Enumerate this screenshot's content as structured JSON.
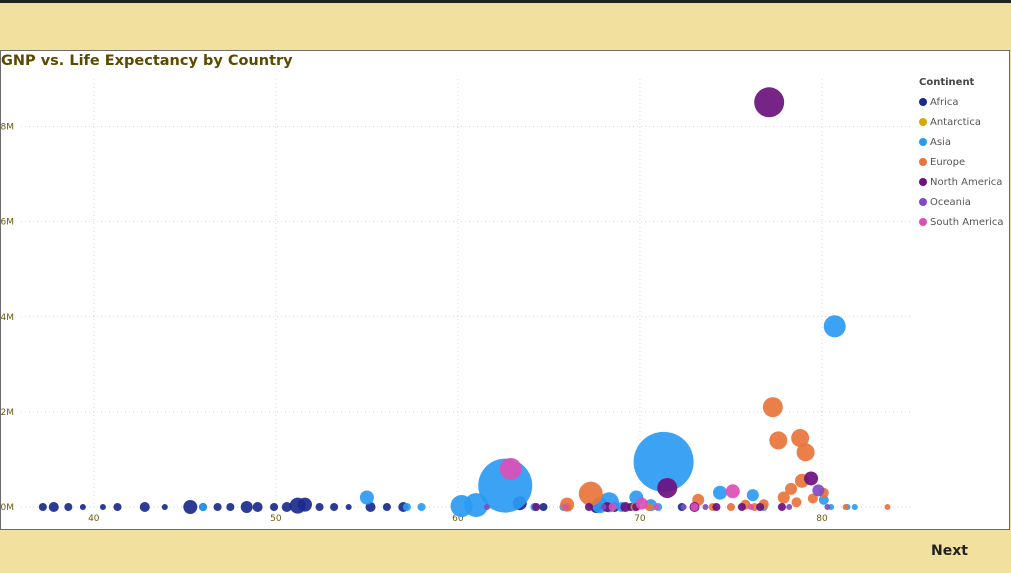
{
  "navigation": {
    "next_label": "Next"
  },
  "chart_data": {
    "type": "scatter",
    "title": "GNP vs. Life Expectancy by Country",
    "xlabel": "",
    "ylabel": "",
    "xlim": [
      36,
      85
    ],
    "ylim": [
      0,
      9000000
    ],
    "x_ticks": [
      40,
      50,
      60,
      70,
      80
    ],
    "y_ticks": [
      {
        "value": 0,
        "label": "0M"
      },
      {
        "value": 2000000,
        "label": "2M"
      },
      {
        "value": 4000000,
        "label": "4M"
      },
      {
        "value": 6000000,
        "label": "6M"
      },
      {
        "value": 8000000,
        "label": "8M"
      }
    ],
    "grid": "dotted",
    "legend_title": "Continent",
    "legend_position": "right",
    "series": [
      {
        "name": "Africa",
        "color": "#1a2a8c",
        "points": [
          {
            "x": 37.2,
            "y": 0,
            "size": 4
          },
          {
            "x": 37.8,
            "y": 0,
            "size": 5
          },
          {
            "x": 38.6,
            "y": 0,
            "size": 4
          },
          {
            "x": 39.4,
            "y": 0,
            "size": 3
          },
          {
            "x": 40.5,
            "y": 0,
            "size": 3
          },
          {
            "x": 41.3,
            "y": 0,
            "size": 4
          },
          {
            "x": 42.8,
            "y": 0,
            "size": 5
          },
          {
            "x": 43.9,
            "y": 0,
            "size": 3
          },
          {
            "x": 45.3,
            "y": 0,
            "size": 7
          },
          {
            "x": 46.0,
            "y": 0,
            "size": 4
          },
          {
            "x": 46.8,
            "y": 0,
            "size": 4
          },
          {
            "x": 47.5,
            "y": 0,
            "size": 4
          },
          {
            "x": 48.4,
            "y": 0,
            "size": 6
          },
          {
            "x": 49.0,
            "y": 0,
            "size": 5
          },
          {
            "x": 49.9,
            "y": 0,
            "size": 4
          },
          {
            "x": 50.6,
            "y": 0,
            "size": 5
          },
          {
            "x": 51.2,
            "y": 30000,
            "size": 8
          },
          {
            "x": 51.6,
            "y": 50000,
            "size": 7
          },
          {
            "x": 52.4,
            "y": 0,
            "size": 4
          },
          {
            "x": 53.2,
            "y": 0,
            "size": 4
          },
          {
            "x": 54.0,
            "y": 0,
            "size": 3
          },
          {
            "x": 55.2,
            "y": 0,
            "size": 5
          },
          {
            "x": 56.1,
            "y": 0,
            "size": 4
          },
          {
            "x": 57.0,
            "y": 0,
            "size": 5
          },
          {
            "x": 63.4,
            "y": 80000,
            "size": 7
          },
          {
            "x": 64.7,
            "y": 0,
            "size": 4
          },
          {
            "x": 66.0,
            "y": 0,
            "size": 4
          },
          {
            "x": 67.6,
            "y": 0,
            "size": 6
          },
          {
            "x": 68.6,
            "y": 0,
            "size": 5
          },
          {
            "x": 69.5,
            "y": 0,
            "size": 4
          },
          {
            "x": 72.3,
            "y": 0,
            "size": 4
          }
        ]
      },
      {
        "name": "Antarctica",
        "color": "#d6a90f",
        "points": []
      },
      {
        "name": "Asia",
        "color": "#2b9af3",
        "points": [
          {
            "x": 46.0,
            "y": 0,
            "size": 4
          },
          {
            "x": 55.0,
            "y": 200000,
            "size": 7
          },
          {
            "x": 57.2,
            "y": 0,
            "size": 4
          },
          {
            "x": 58.0,
            "y": 0,
            "size": 4
          },
          {
            "x": 60.2,
            "y": 20000,
            "size": 11
          },
          {
            "x": 61.0,
            "y": 40000,
            "size": 12
          },
          {
            "x": 62.6,
            "y": 450000,
            "size": 27
          },
          {
            "x": 64.2,
            "y": 0,
            "size": 4
          },
          {
            "x": 65.8,
            "y": 0,
            "size": 4
          },
          {
            "x": 67.8,
            "y": 40000,
            "size": 8
          },
          {
            "x": 68.3,
            "y": 100000,
            "size": 10
          },
          {
            "x": 69.0,
            "y": 0,
            "size": 5
          },
          {
            "x": 69.8,
            "y": 200000,
            "size": 7
          },
          {
            "x": 70.6,
            "y": 40000,
            "size": 6
          },
          {
            "x": 71.0,
            "y": 0,
            "size": 4
          },
          {
            "x": 71.3,
            "y": 950000,
            "size": 30
          },
          {
            "x": 74.4,
            "y": 300000,
            "size": 7
          },
          {
            "x": 76.2,
            "y": 250000,
            "size": 6
          },
          {
            "x": 76.8,
            "y": 0,
            "size": 4
          },
          {
            "x": 80.1,
            "y": 150000,
            "size": 5
          },
          {
            "x": 80.5,
            "y": 0,
            "size": 3
          },
          {
            "x": 80.7,
            "y": 3800000,
            "size": 11
          },
          {
            "x": 81.4,
            "y": 0,
            "size": 3
          },
          {
            "x": 81.8,
            "y": 0,
            "size": 3
          }
        ]
      },
      {
        "name": "Europe",
        "color": "#e8743b",
        "points": [
          {
            "x": 66.0,
            "y": 50000,
            "size": 7
          },
          {
            "x": 67.3,
            "y": 280000,
            "size": 12
          },
          {
            "x": 69.7,
            "y": 0,
            "size": 4
          },
          {
            "x": 70.5,
            "y": 0,
            "size": 4
          },
          {
            "x": 73.2,
            "y": 150000,
            "size": 6
          },
          {
            "x": 74.0,
            "y": 0,
            "size": 4
          },
          {
            "x": 75.0,
            "y": 0,
            "size": 4
          },
          {
            "x": 75.8,
            "y": 50000,
            "size": 5
          },
          {
            "x": 76.3,
            "y": 0,
            "size": 4
          },
          {
            "x": 76.8,
            "y": 60000,
            "size": 5
          },
          {
            "x": 77.3,
            "y": 2100000,
            "size": 10
          },
          {
            "x": 77.6,
            "y": 1400000,
            "size": 9
          },
          {
            "x": 77.9,
            "y": 200000,
            "size": 6
          },
          {
            "x": 78.3,
            "y": 380000,
            "size": 6
          },
          {
            "x": 78.6,
            "y": 100000,
            "size": 5
          },
          {
            "x": 78.8,
            "y": 1450000,
            "size": 9
          },
          {
            "x": 78.9,
            "y": 550000,
            "size": 7
          },
          {
            "x": 79.1,
            "y": 1150000,
            "size": 9
          },
          {
            "x": 79.5,
            "y": 180000,
            "size": 5
          },
          {
            "x": 80.1,
            "y": 300000,
            "size": 5
          },
          {
            "x": 83.6,
            "y": 0,
            "size": 3
          },
          {
            "x": 81.3,
            "y": 0,
            "size": 3
          }
        ]
      },
      {
        "name": "North America",
        "color": "#6a117e",
        "points": [
          {
            "x": 64.3,
            "y": 0,
            "size": 4
          },
          {
            "x": 67.2,
            "y": 0,
            "size": 4
          },
          {
            "x": 68.2,
            "y": 0,
            "size": 5
          },
          {
            "x": 69.2,
            "y": 0,
            "size": 5
          },
          {
            "x": 69.8,
            "y": 0,
            "size": 4
          },
          {
            "x": 71.5,
            "y": 400000,
            "size": 10
          },
          {
            "x": 73.0,
            "y": 0,
            "size": 5
          },
          {
            "x": 74.2,
            "y": 0,
            "size": 4
          },
          {
            "x": 75.6,
            "y": 0,
            "size": 4
          },
          {
            "x": 76.6,
            "y": 0,
            "size": 4
          },
          {
            "x": 77.1,
            "y": 8510000,
            "size": 15
          },
          {
            "x": 77.8,
            "y": 0,
            "size": 4
          },
          {
            "x": 79.4,
            "y": 600000,
            "size": 7
          }
        ]
      },
      {
        "name": "Oceania",
        "color": "#7f4bc4",
        "points": [
          {
            "x": 61.6,
            "y": 0,
            "size": 3
          },
          {
            "x": 68.0,
            "y": 0,
            "size": 3
          },
          {
            "x": 72.4,
            "y": 0,
            "size": 3
          },
          {
            "x": 73.6,
            "y": 0,
            "size": 3
          },
          {
            "x": 78.2,
            "y": 0,
            "size": 3
          },
          {
            "x": 79.8,
            "y": 350000,
            "size": 6
          },
          {
            "x": 80.3,
            "y": 0,
            "size": 3
          }
        ]
      },
      {
        "name": "South America",
        "color": "#db4fb6",
        "points": [
          {
            "x": 62.9,
            "y": 800000,
            "size": 11
          },
          {
            "x": 65.9,
            "y": 0,
            "size": 3
          },
          {
            "x": 68.5,
            "y": 0,
            "size": 4
          },
          {
            "x": 70.1,
            "y": 70000,
            "size": 6
          },
          {
            "x": 70.9,
            "y": 0,
            "size": 3
          },
          {
            "x": 73.0,
            "y": 0,
            "size": 4
          },
          {
            "x": 75.1,
            "y": 330000,
            "size": 7
          },
          {
            "x": 76.1,
            "y": 0,
            "size": 3
          }
        ]
      }
    ]
  }
}
